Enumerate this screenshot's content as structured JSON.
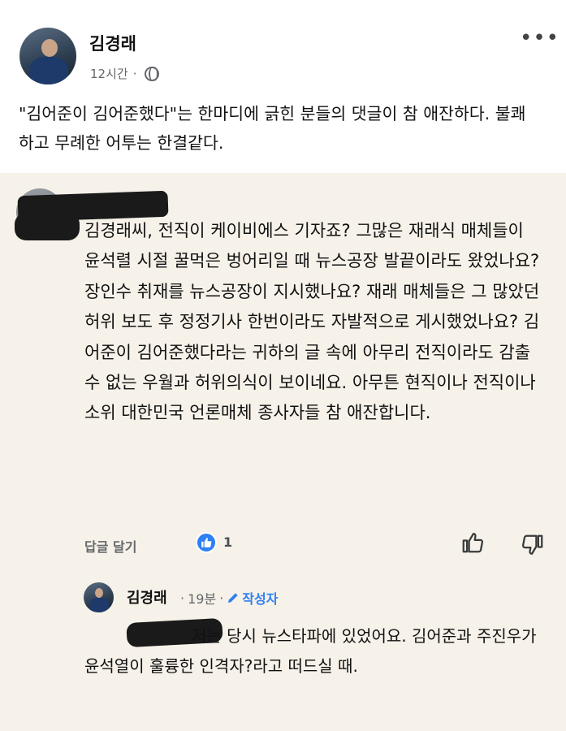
{
  "post": {
    "author": "김경래",
    "time": "12시간",
    "separator": "·",
    "more_label": "•••",
    "text": "\"김어준이 김어준했다\"는 한마디에 긁힌 분들의 댓글이 참 애잔하다. 불쾌하고 무례한 어투는 한결같다."
  },
  "comment": {
    "text": "김경래씨, 전직이 케이비에스 기자죠? 그많은 재래식 매체들이 윤석렬 시절 꿀먹은 벙어리일 때 뉴스공장 발끝이라도 왔었나요?  장인수 취재를 뉴스공장이 지시했나요? 재래 매체들은 그 많았던 허위 보도 후 정정기사 한번이라도 자발적으로 게시했었나요? 김어준이 김어준했다라는 귀하의 글 속에 아무리 전직이라도 감출 수 없는 우월과 허위의식이 보이네요. 아무튼 현직이나 전직이나 소위 대한민국 언론매체 종사자들 참 애잔합니다.",
    "reply_label": "답글 달기",
    "like_count": "1"
  },
  "reply": {
    "author": "김경래",
    "time": "19분",
    "separator": "·",
    "author_badge": "작성자",
    "text": "저는 당시 뉴스타파에 있었어요. 김어준과 주진우가 윤석열이 훌륭한 인격자?라고 떠드실 때."
  },
  "colors": {
    "accent": "#2f7ff5",
    "comment_bg": "#f6f2e9",
    "post_bg": "#ffffff",
    "muted": "#65676b"
  }
}
